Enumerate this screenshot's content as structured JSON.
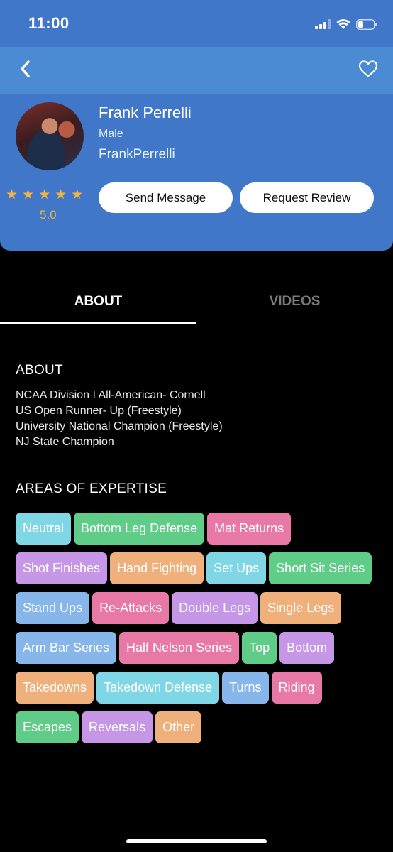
{
  "status_bar": {
    "time": "11:00"
  },
  "profile": {
    "name": "Frank Perrelli",
    "gender": "Male",
    "username": "FrankPerrelli",
    "stars": 5,
    "rating": "5.0"
  },
  "actions": {
    "send_message": "Send Message",
    "request_review": "Request Review"
  },
  "tabs": [
    {
      "label": "ABOUT",
      "active": true
    },
    {
      "label": "VIDEOS",
      "active": false
    }
  ],
  "about": {
    "heading": "ABOUT",
    "lines": [
      "NCAA Division I All-American- Cornell",
      "US Open Runner- Up (Freestyle)",
      "University National Champion (Freestyle)",
      "NJ State Champion"
    ]
  },
  "expertise": {
    "heading": "AREAS OF EXPERTISE",
    "tags": [
      {
        "label": "Neutral",
        "color": "#7fd7e6"
      },
      {
        "label": "Bottom Leg Defense",
        "color": "#5fcc88"
      },
      {
        "label": "Mat Returns",
        "color": "#e879a7"
      },
      {
        "label": "Shot Finishes",
        "color": "#c597e6"
      },
      {
        "label": "Hand Fighting",
        "color": "#f0b07c"
      },
      {
        "label": "Set Ups",
        "color": "#7fd7e6"
      },
      {
        "label": "Short Sit Series",
        "color": "#5fcc88"
      },
      {
        "label": "Stand Ups",
        "color": "#86b6ea"
      },
      {
        "label": "Re-Attacks",
        "color": "#e879a7"
      },
      {
        "label": "Double Legs",
        "color": "#c597e6"
      },
      {
        "label": "Single Legs",
        "color": "#f0b07c"
      },
      {
        "label": "Arm Bar Series",
        "color": "#86b6ea"
      },
      {
        "label": "Half Nelson Series",
        "color": "#e879a7"
      },
      {
        "label": "Top",
        "color": "#5fcc88"
      },
      {
        "label": "Bottom",
        "color": "#c597e6"
      },
      {
        "label": "Takedowns",
        "color": "#f0b07c"
      },
      {
        "label": "Takedown Defense",
        "color": "#7fd7e6"
      },
      {
        "label": "Turns",
        "color": "#86b6ea"
      },
      {
        "label": "Riding",
        "color": "#e879a7"
      },
      {
        "label": "Escapes",
        "color": "#5fcc88"
      },
      {
        "label": "Reversals",
        "color": "#c597e6"
      },
      {
        "label": "Other",
        "color": "#f0b07c"
      }
    ]
  },
  "icons": {
    "back": "chevron-left-icon",
    "favorite": "heart-outline-icon",
    "signal": "cellular-signal-icon",
    "wifi": "wifi-icon",
    "battery": "battery-icon",
    "star": "star-icon"
  },
  "colors": {
    "header_bg": "#4177c9",
    "nav_bg": "#4b8bd4",
    "star": "#f3b33d",
    "page_bg": "#000000"
  }
}
